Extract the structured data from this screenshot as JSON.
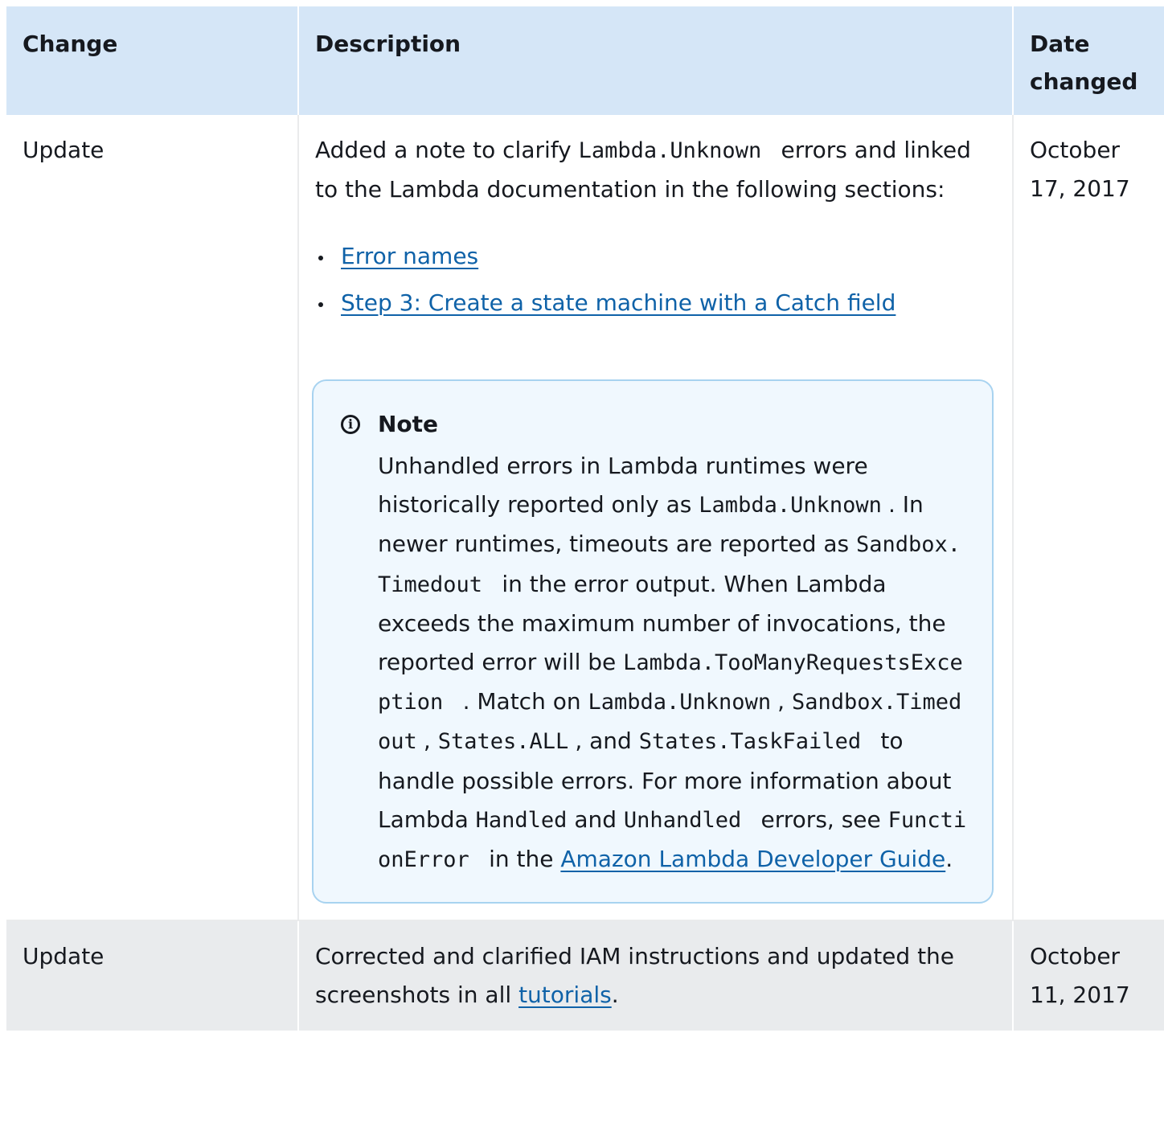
{
  "table": {
    "headers": {
      "change": "Change",
      "description": "Description",
      "date": "Date changed"
    },
    "rows": [
      {
        "change": "Update",
        "description": {
          "p1_a": "Added a note to clarify ",
          "p1_code": "Lambda.Unknown",
          "p1_b": "errors and linked to the Lambda documentation in the following sections:",
          "links": [
            "Error names",
            "Step 3: Create a state machine with a Catch field"
          ],
          "note": {
            "title": "Note",
            "t1": "Unhandled errors in Lambda runtimes were historically reported only as ",
            "c1": "Lambda.Unknown",
            "t2": ". In newer runtimes, timeouts are reported as ",
            "c2": "Sandbox.Timedout",
            "t3": "in the error output. When Lambda exceeds the maximum number of invocations, the reported error will be ",
            "c3": "Lambda.TooManyRequestsException",
            "t4": ". Match on ",
            "c4": "Lambda.Unknown",
            "t5": ", ",
            "c5": "Sandbox.Timedout",
            "t6": ", ",
            "c6": "States.ALL",
            "t7": ", and ",
            "c7": "States.TaskFailed",
            "t8": "to handle possible errors. For more information about Lambda ",
            "c8": "Handled",
            "t9": " and ",
            "c9": "Unhandled",
            "t10": "errors, see ",
            "c10": "FunctionError",
            "t11": "in the ",
            "link": "Amazon Lambda Developer Guide",
            "t12": "."
          }
        },
        "date": "October 17, 2017"
      },
      {
        "change": "Update",
        "description": {
          "a": "Corrected and clarified IAM instructions and updated the screenshots in all ",
          "link": "tutorials",
          "b": "."
        },
        "date": "October 11, 2017"
      }
    ]
  },
  "colors": {
    "header_bg": "#d5e6f7",
    "link": "#0f62a8",
    "note_bg": "#f0f8fe",
    "note_border": "#a8d3f0",
    "row_alt_bg": "#e9ebed"
  },
  "icons": {
    "note": "info-circle-icon"
  }
}
